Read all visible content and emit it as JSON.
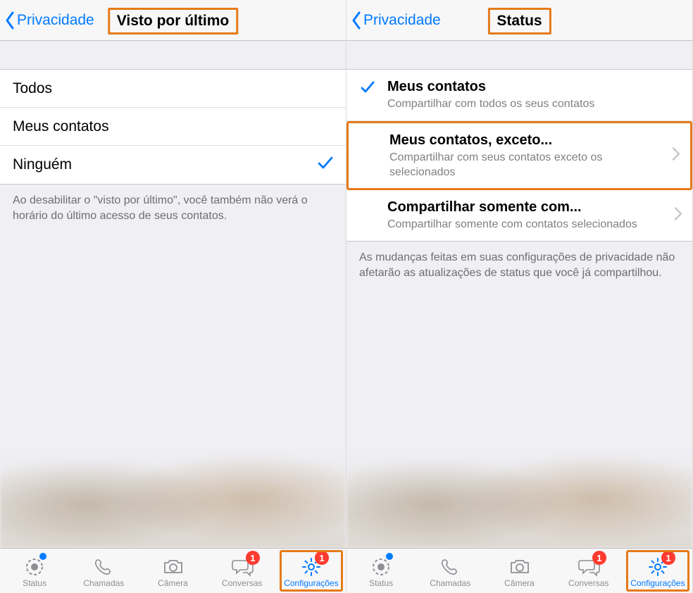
{
  "left": {
    "back_label": "Privacidade",
    "title": "Visto por último",
    "options": {
      "all": "Todos",
      "contacts": "Meus contatos",
      "nobody": "Ninguém"
    },
    "footer": "Ao desabilitar o \"visto por último\", você também não verá o horário do último acesso de seus contatos."
  },
  "right": {
    "back_label": "Privacidade",
    "title": "Status",
    "rows": {
      "r0": {
        "title": "Meus contatos",
        "sub": "Compartilhar com todos os seus contatos"
      },
      "r1": {
        "title": "Meus contatos, exceto...",
        "sub": "Compartilhar com seus contatos exceto os selecionados"
      },
      "r2": {
        "title": "Compartilhar somente com...",
        "sub": "Compartilhar somente com contatos selecionados"
      }
    },
    "footer": "As mudanças feitas em suas configurações de privacidade não afetarão as atualizações de status que você já compartilhou."
  },
  "tabs": {
    "status": "Status",
    "calls": "Chamadas",
    "camera": "Câmera",
    "chats": "Conversas",
    "settings": "Configurações",
    "badge_chats": "1",
    "badge_settings": "1"
  }
}
